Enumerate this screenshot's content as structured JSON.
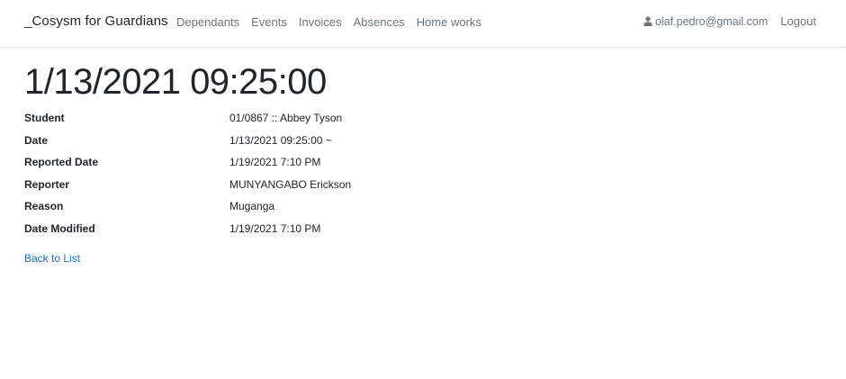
{
  "navbar": {
    "brand": "_Cosysm for Guardians",
    "links": [
      "Dependants",
      "Events",
      "Invoices",
      "Absences",
      "Home works"
    ],
    "user_email": "olaf.pedro@gmail.com",
    "logout_label": "Logout",
    "user_icon": "user-icon"
  },
  "page": {
    "title": "1/13/2021 09:25:00",
    "details": [
      {
        "label": "Student",
        "value": "01/0867 :: Abbey Tyson"
      },
      {
        "label": "Date",
        "value": "1/13/2021 09:25:00 ~"
      },
      {
        "label": "Reported Date",
        "value": "1/19/2021 7:10 PM"
      },
      {
        "label": "Reporter",
        "value": "MUNYANGABO Erickson"
      },
      {
        "label": "Reason",
        "value": "Muganga"
      },
      {
        "label": "Date Modified",
        "value": "1/19/2021 7:10 PM"
      }
    ],
    "back_link": "Back to List"
  },
  "colors": {
    "link": "#1b6ec2",
    "nav_text": "#6c757d",
    "text": "#212529"
  }
}
